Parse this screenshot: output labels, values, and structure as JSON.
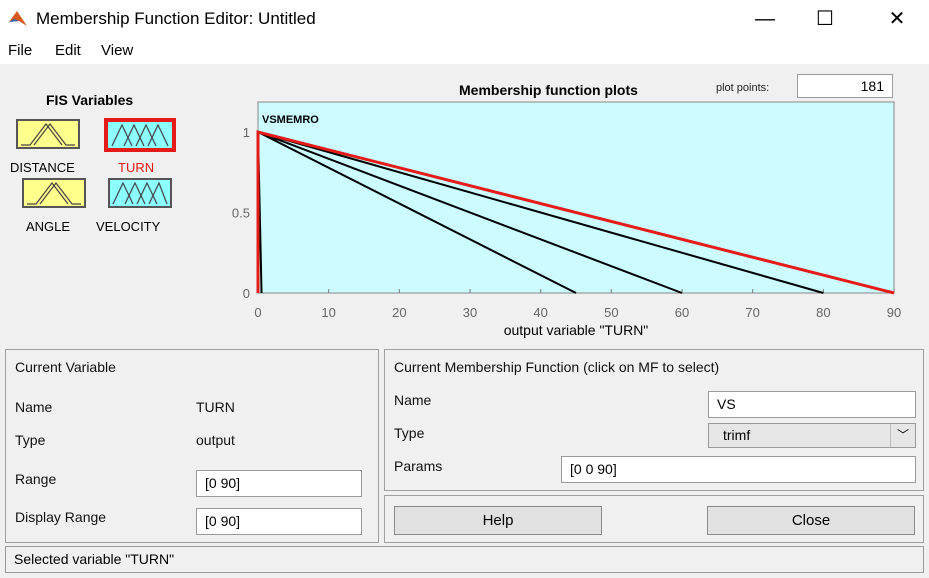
{
  "window": {
    "title": "Membership Function Editor: Untitled",
    "minimize_glyph": "—",
    "maximize_glyph": "☐",
    "close_glyph": "✕"
  },
  "menu": [
    "File",
    "Edit",
    "View"
  ],
  "fis_variables": {
    "title": "FIS Variables",
    "items": [
      {
        "label": "DISTANCE",
        "type": "input",
        "color": "#ffff8c",
        "selected": false
      },
      {
        "label": "TURN",
        "type": "output",
        "color": "#8cffff",
        "selected": true
      },
      {
        "label": "ANGLE",
        "type": "input",
        "color": "#ffff8c",
        "selected": false
      },
      {
        "label": "VELOCITY",
        "type": "output",
        "color": "#8cffff",
        "selected": false
      }
    ]
  },
  "plot": {
    "title": "Membership function plots",
    "plot_points_label": "plot points:",
    "plot_points": "181",
    "xlabel": "output variable \"TURN\"",
    "mf_label_text": "VSMEMRO"
  },
  "chart_data": {
    "type": "line",
    "title": "Membership function plots",
    "xlabel": "output variable \"TURN\"",
    "ylabel": "",
    "xlim": [
      0,
      90
    ],
    "ylim": [
      0,
      1
    ],
    "xticks": [
      0,
      10,
      20,
      30,
      40,
      50,
      60,
      70,
      80,
      90
    ],
    "yticks": [
      0,
      0.5,
      1
    ],
    "background": "#ccfcff",
    "series": [
      {
        "x": [
          0,
          0,
          0.5
        ],
        "y": [
          0,
          1,
          0
        ],
        "color": "#000000",
        "selected": false
      },
      {
        "x": [
          0,
          0,
          45
        ],
        "y": [
          0,
          1,
          0
        ],
        "color": "#000000",
        "selected": false
      },
      {
        "x": [
          0,
          0,
          60
        ],
        "y": [
          0,
          1,
          0
        ],
        "color": "#000000",
        "selected": false
      },
      {
        "x": [
          0,
          0,
          80
        ],
        "y": [
          0,
          1,
          0
        ],
        "color": "#000000",
        "selected": false
      },
      {
        "x": [
          0,
          0,
          90
        ],
        "y": [
          0,
          1,
          0
        ],
        "color": "#e41b17",
        "selected": true
      }
    ]
  },
  "current_variable": {
    "title": "Current Variable",
    "name_label": "Name",
    "name": "TURN",
    "type_label": "Type",
    "type": "output",
    "range_label": "Range",
    "range": "[0 90]",
    "display_range_label": "Display Range",
    "display_range": "[0 90]"
  },
  "current_mf": {
    "title": "Current Membership Function (click on MF to select)",
    "name_label": "Name",
    "name": "VS",
    "type_label": "Type",
    "type": "trimf",
    "params_label": "Params",
    "params": "[0 0 90]"
  },
  "buttons": {
    "help": "Help",
    "close": "Close"
  },
  "status": "Selected variable \"TURN\"",
  "colors": {
    "selected_mf": "#e41b17",
    "plot_bg": "#ccfcff",
    "input_var": "#ffff8c",
    "output_var": "#8cffff"
  }
}
